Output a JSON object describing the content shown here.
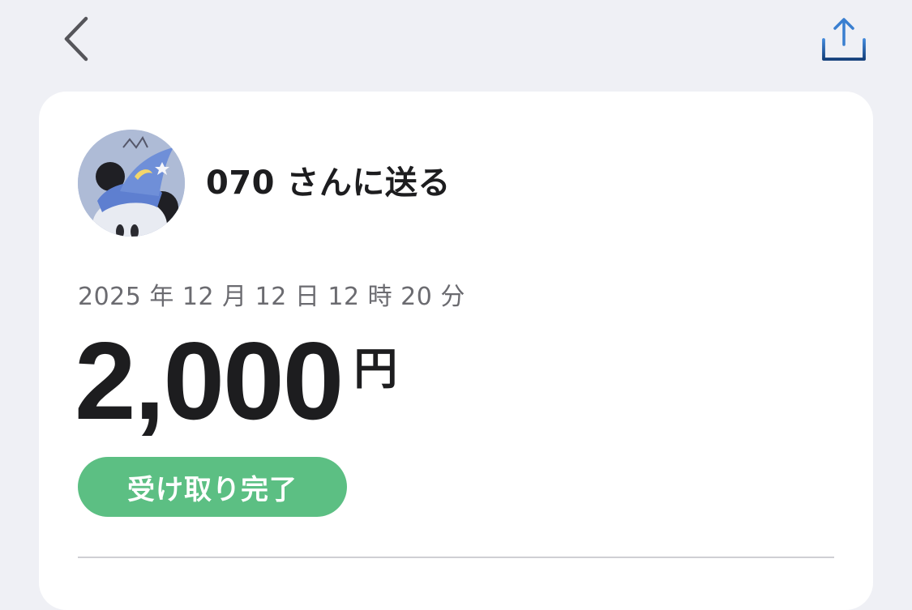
{
  "nav": {
    "back_icon": "chevron-left-icon",
    "share_icon": "share-icon",
    "accent_color": "#1f4f8f"
  },
  "transfer": {
    "recipient_label": "070 さんに送る",
    "datetime": "2025 年 12 月 12 日 12 時 20 分",
    "amount": "2,000",
    "currency": "円",
    "status": "受け取り完了",
    "status_color": "#5cbf83"
  }
}
